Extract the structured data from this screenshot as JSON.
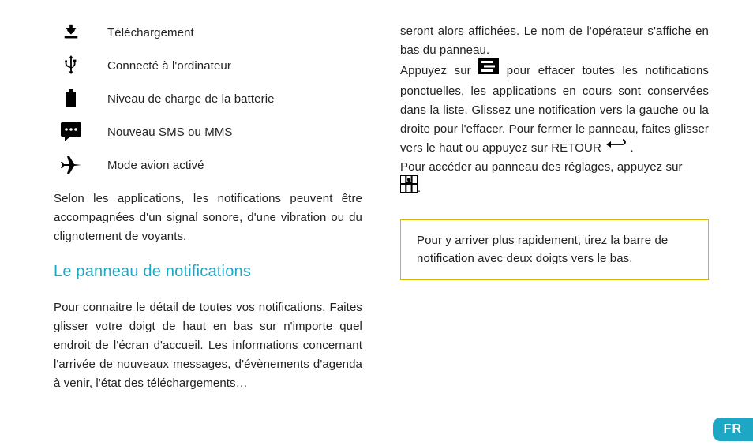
{
  "left": {
    "icons": [
      {
        "name": "download-icon",
        "label": "Téléchargement"
      },
      {
        "name": "usb-icon",
        "label": "Connecté à l'ordinateur"
      },
      {
        "name": "battery-icon",
        "label": "Niveau de charge de la batterie"
      },
      {
        "name": "sms-icon",
        "label": "Nouveau SMS ou MMS"
      },
      {
        "name": "airplane-icon",
        "label": "Mode avion activé"
      }
    ],
    "notif_para": "Selon les applications, les notifications peuvent être accompagnées d'un signal sonore, d'une vibration ou du clignotement de voyants.",
    "section_title": "Le panneau de notifications",
    "panel_para": "Pour connaitre le détail de toutes vos notifications. Faites glisser votre doigt de haut en bas sur n'importe quel endroit de l'écran d'accueil. Les informations concernant l'arrivée de nouveaux messages, d'évènements d'agenda à venir, l'état des téléchargements…"
  },
  "right": {
    "para1": "seront alors affichées. Le nom de l'opérateur s'affiche en bas du panneau.",
    "para2a": "Appuyez sur ",
    "para2b": " pour effacer toutes les notifications ponctuelles, les applications en cours sont conservées dans la liste. Glissez une notification vers la gauche ou la droite pour l'effacer. Pour fermer le panneau, faites glisser vers le haut ou appuyez sur RETOUR ",
    "para2c": " .",
    "para3a": "Pour accéder au panneau des réglages, appuyez sur ",
    "para3b": ".",
    "tip": "Pour y arriver plus rapidement, tirez la barre de notification avec deux doigts vers le bas."
  },
  "lang_badge": "FR"
}
